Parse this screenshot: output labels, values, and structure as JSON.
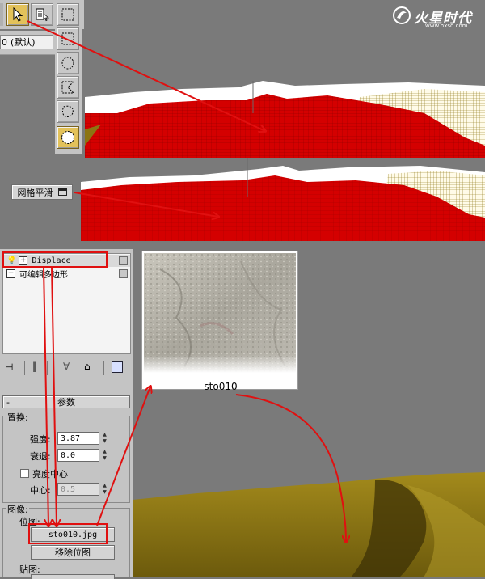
{
  "watermark": {
    "brand": "火星时代",
    "url": "www.hxsd.com"
  },
  "toolbar": {
    "default_label": "(默认)",
    "default_prefix": "0"
  },
  "meshsmooth": {
    "label": "网格平滑"
  },
  "stack": {
    "items": [
      {
        "label": "Displace"
      },
      {
        "label": "可编辑多边形"
      }
    ]
  },
  "params": {
    "header": "参数",
    "header_collapse": "-",
    "displace_group": "置换:",
    "strength_label": "强度:",
    "strength_value": "3.87",
    "decay_label": "衰退:",
    "decay_value": "0.0",
    "luminance_center_label": "亮度中心",
    "center_label": "中心:",
    "center_value": "0.5",
    "image_group": "图像:",
    "bitmap_label": "位图:",
    "bitmap_button": "sto010.jpg",
    "remove_bitmap_button": "移除位图",
    "map_label": "贴图:"
  },
  "thumbnail": {
    "caption": "sto010"
  },
  "colors": {
    "annotation_red": "#e01010",
    "terrain_red": "#d40000",
    "terrain_gold": "#8c7412",
    "active_tool": "#e3c25a"
  }
}
